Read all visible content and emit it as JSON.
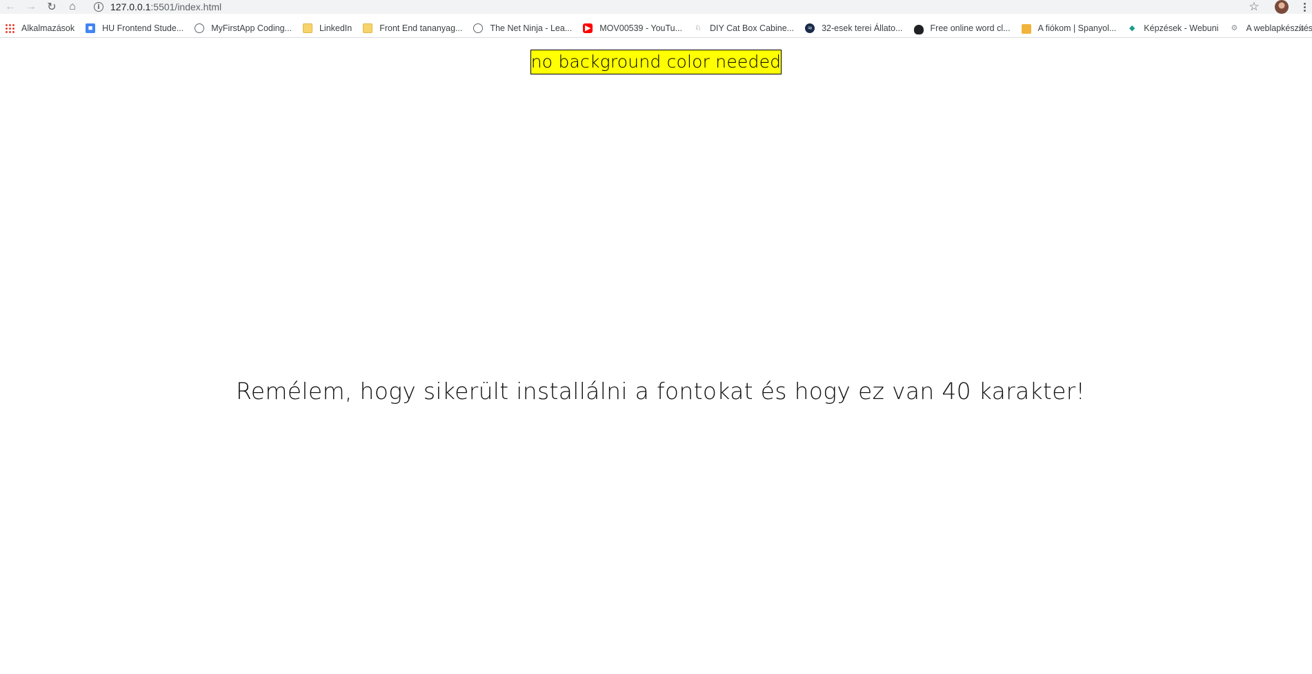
{
  "browser": {
    "url_host": "127.0.0.1",
    "url_path": ":5501/index.html",
    "bookmarks": [
      {
        "label": "Alkalmazások",
        "icon": "apps-grid-icon"
      },
      {
        "label": "HU Frontend Stude...",
        "icon": "hu-icon"
      },
      {
        "label": "MyFirstApp Coding...",
        "icon": "globe-icon"
      },
      {
        "label": "LinkedIn",
        "icon": "folder-icon"
      },
      {
        "label": "Front End tananyag...",
        "icon": "folder-icon"
      },
      {
        "label": "The Net Ninja - Lea...",
        "icon": "globe-icon"
      },
      {
        "label": "MOV00539 - YouTu...",
        "icon": "youtube-icon"
      },
      {
        "label": "DIY Cat Box Cabine...",
        "icon": "cat-icon"
      },
      {
        "label": "32-esek terei Állato...",
        "icon": "wave-icon"
      },
      {
        "label": "Free online word cl...",
        "icon": "cloud-icon"
      },
      {
        "label": "A fiókom | Spanyol...",
        "icon": "card-icon"
      },
      {
        "label": "Képzések - Webuni",
        "icon": "graduation-cap-icon"
      },
      {
        "label": "A weblapkészítés te...",
        "icon": "gear-icon"
      }
    ]
  },
  "page": {
    "highlight_text": "no background color needed",
    "main_text": "Remélem, hogy sikerült installálni a fontokat és hogy ez van 40 karakter!"
  },
  "colors": {
    "highlight_background": "#ffff00",
    "toolbar_background": "#f1f3f4"
  }
}
